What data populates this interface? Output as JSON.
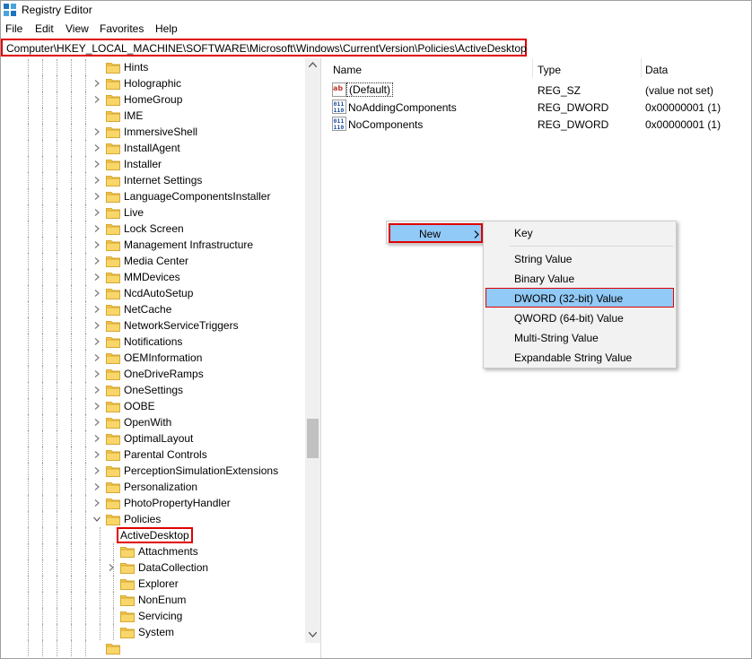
{
  "window": {
    "title": "Registry Editor"
  },
  "menu": {
    "file": "File",
    "edit": "Edit",
    "view": "View",
    "favorites": "Favorites",
    "help": "Help"
  },
  "address": {
    "path": "Computer\\HKEY_LOCAL_MACHINE\\SOFTWARE\\Microsoft\\Windows\\CurrentVersion\\Policies\\ActiveDesktop"
  },
  "tree": {
    "items": [
      "Hints",
      "Holographic",
      "HomeGroup",
      "IME",
      "ImmersiveShell",
      "InstallAgent",
      "Installer",
      "Internet Settings",
      "LanguageComponentsInstaller",
      "Live",
      "Lock Screen",
      "Management Infrastructure",
      "Media Center",
      "MMDevices",
      "NcdAutoSetup",
      "NetCache",
      "NetworkServiceTriggers",
      "Notifications",
      "OEMInformation",
      "OneDriveRamps",
      "OneSettings",
      "OOBE",
      "OpenWith",
      "OptimalLayout",
      "Parental Controls",
      "PerceptionSimulationExtensions",
      "Personalization",
      "PhotoPropertyHandler",
      "Policies"
    ],
    "policies_children": [
      "ActiveDesktop",
      "Attachments",
      "DataCollection",
      "Explorer",
      "NonEnum",
      "Servicing",
      "System"
    ]
  },
  "list": {
    "headers": {
      "name": "Name",
      "type": "Type",
      "data": "Data"
    },
    "rows": [
      {
        "name": "(Default)",
        "type": "REG_SZ",
        "data": "(value not set)",
        "icon": "string-value-icon"
      },
      {
        "name": "NoAddingComponents",
        "type": "REG_DWORD",
        "data": "0x00000001 (1)",
        "icon": "binary-value-icon"
      },
      {
        "name": "NoComponents",
        "type": "REG_DWORD",
        "data": "0x00000001 (1)",
        "icon": "binary-value-icon"
      }
    ]
  },
  "context_menu": {
    "new_label": "New",
    "submenu": {
      "key": "Key",
      "string_value": "String Value",
      "binary_value": "Binary Value",
      "dword_value": "DWORD (32-bit) Value",
      "qword_value": "QWORD (64-bit) Value",
      "multi_string_value": "Multi-String Value",
      "expandable_string_value": "Expandable String Value"
    }
  },
  "colors": {
    "highlight": "#91c9f7",
    "annotation_red": "#e00000",
    "folder": "#f4c84b"
  }
}
